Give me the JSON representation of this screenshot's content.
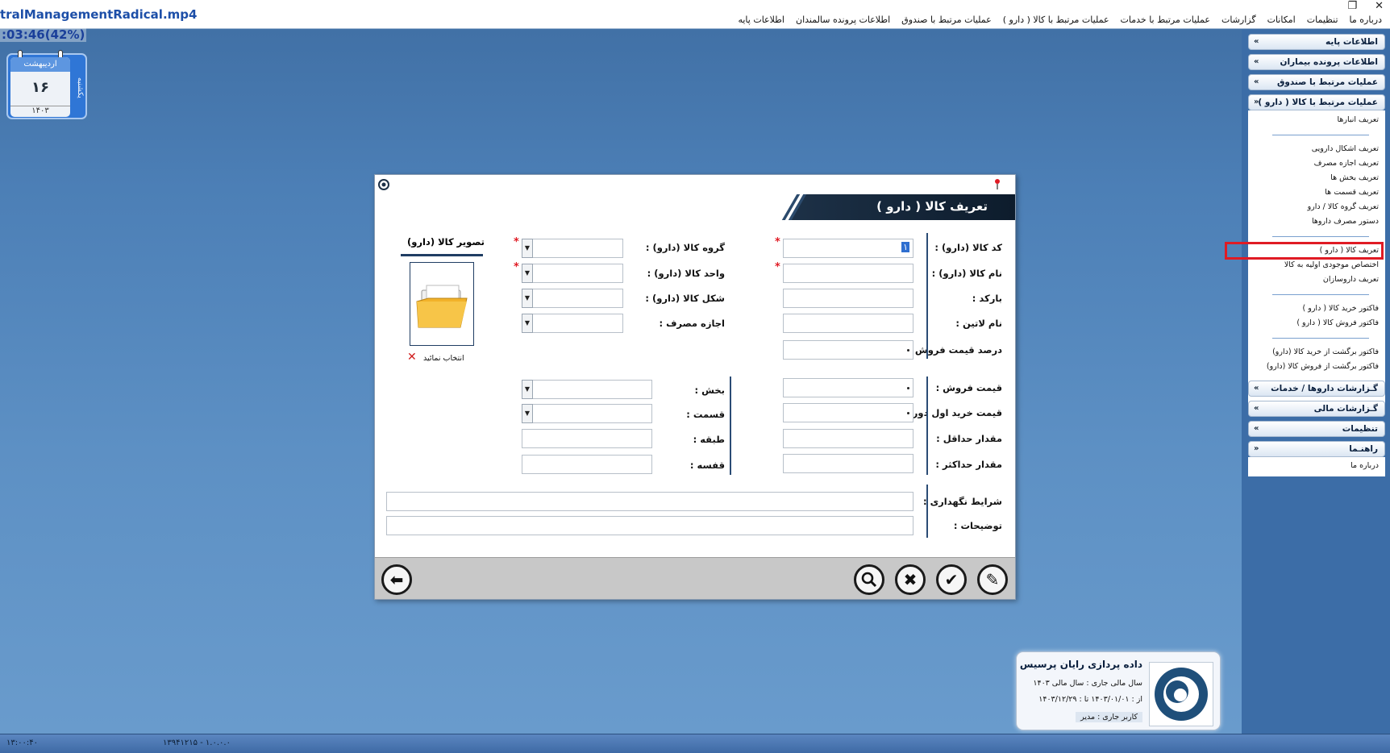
{
  "video": {
    "title": "tralManagementRadical.mp4",
    "timer": ":03:46(42%)"
  },
  "window_controls": {
    "restore": "❐",
    "close": "✕"
  },
  "menu": {
    "items": [
      "اطلاعات پایه",
      "اطلاعات پرونده سالمندان",
      "عملیات مرتبط با صندوق",
      "عملیات مرتبط با کالا ( دارو )",
      "عملیات مرتبط با خدمات",
      "گزارشات",
      "امکانات",
      "تنظیمات",
      "درباره ما"
    ]
  },
  "calendar": {
    "month": "اردیبهشت",
    "day": "۱۶",
    "year": "۱۴۰۳",
    "weekday": "یکشنبه"
  },
  "side_panel": {
    "headers": [
      {
        "label": "اطلاعات پایه",
        "state": "collapsed"
      },
      {
        "label": "اطلاعات پرونده بیماران",
        "state": "collapsed"
      },
      {
        "label": "عملیات مرتبط با صندوق",
        "state": "collapsed"
      },
      {
        "label": "عملیات مرتبط با کالا ( دارو )",
        "state": "expanded"
      },
      {
        "label": "گـزارشات داروها / خدمات",
        "state": "collapsed"
      },
      {
        "label": "گـزارشات مالی",
        "state": "collapsed"
      },
      {
        "label": "تنظیمات",
        "state": "collapsed"
      },
      {
        "label": "راهنـما",
        "state": "expanded"
      }
    ],
    "drug_items": [
      "تعریف انبارها",
      "تعریف اشکال دارویی",
      "تعریف اجازه مصرف",
      "تعریف بخش ها",
      "تعریف قسمت ها",
      "تعریف گروه کالا / دارو",
      "دستور مصرف داروها",
      "تعریف کالا ( دارو )",
      "اختصاص موجودی اولیه به کالا",
      "تعریف داروسازان",
      "فاکتور خرید کالا ( دارو )",
      "فاکتور فروش کالا ( دارو )",
      "فاکتور برگشت از خرید کالا (دارو)",
      "فاکتور برگشت از فروش کالا (دارو)"
    ],
    "help_items": [
      "درباره ما"
    ],
    "highlighted_item": "تعریف کالا ( دارو )"
  },
  "dialog": {
    "title": "تعریف کالا ( دارو )",
    "fields_right": [
      {
        "label": "کد کالا (دارو) :",
        "value": "۱",
        "required": true
      },
      {
        "label": "نام کالا (دارو) :",
        "value": "",
        "required": true
      },
      {
        "label": "بارکد :",
        "value": "",
        "required": false
      },
      {
        "label": "نام لاتین :",
        "value": "",
        "required": false
      },
      {
        "label": "درصد قیمت فروش :",
        "value": "",
        "required": false
      }
    ],
    "fields_middle": [
      {
        "label": "گروه کالا (دارو) :",
        "value": "",
        "required": true
      },
      {
        "label": "واحد کالا (دارو) :",
        "value": "",
        "required": true
      },
      {
        "label": "شکل کالا (دارو) :",
        "value": "",
        "required": false
      },
      {
        "label": "اجازه مصرف :",
        "value": "",
        "required": false
      }
    ],
    "fields_right_lower": [
      {
        "label": "قیمت فروش :",
        "value": ""
      },
      {
        "label": "قیمت خرید اول دوره :",
        "value": ""
      },
      {
        "label": "مقدار حداقل :",
        "value": ""
      },
      {
        "label": "مقدار حداکثر :",
        "value": ""
      }
    ],
    "fields_middle_lower": [
      {
        "label": "بخش :",
        "value": "",
        "combo": true
      },
      {
        "label": "قسمت :",
        "value": "",
        "combo": true
      },
      {
        "label": "طبقه :",
        "value": "",
        "combo": false
      },
      {
        "label": "قفسه :",
        "value": "",
        "combo": false
      }
    ],
    "fields_wide": [
      {
        "label": "شرایط نگهداری :",
        "value": ""
      },
      {
        "label": "توضیحات :",
        "value": ""
      }
    ],
    "photo": {
      "label": "تصویر کالا (دارو)",
      "select_text": "انتخاب نمائید",
      "clear_icon": "✕"
    },
    "buttons": {
      "back": "⬅",
      "search": "🔍",
      "cancel": "✖",
      "confirm": "✔",
      "edit": "✎"
    }
  },
  "company": {
    "name": "داده پردازی رایان پرسیس",
    "fiscal_year": "سال مالی جاری :   سال مالی ۱۴۰۳",
    "date_range": "از : ۱۴۰۳/۰۱/۰۱   تا : ۱۴۰۳/۱۲/۲۹",
    "current_user": "کاربر جاری :      مدیر"
  },
  "status": {
    "time": "۱۳:۰۰:۴۰",
    "version": "۱۳۹۴۱۲۱۵ - ۱.۰.۰.۰"
  }
}
